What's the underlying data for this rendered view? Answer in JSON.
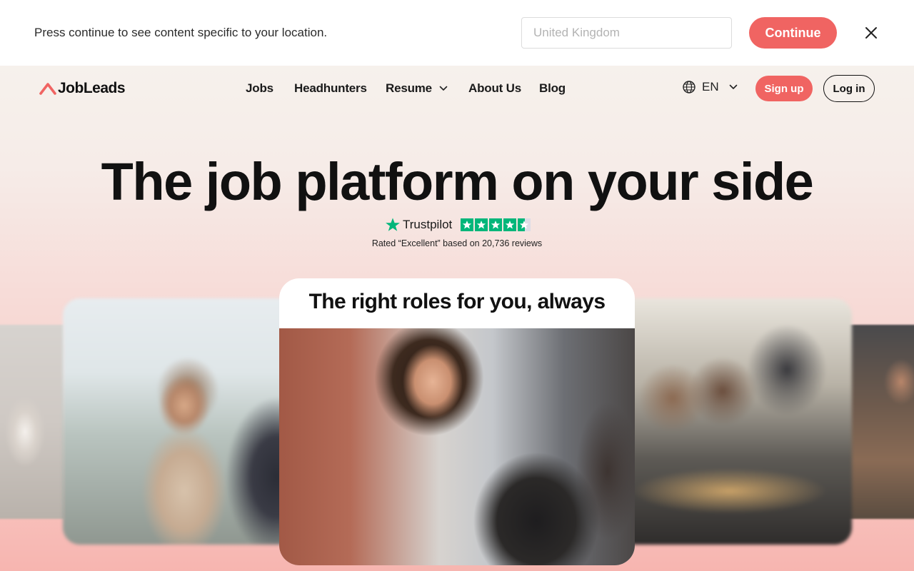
{
  "location_banner": {
    "message": "Press continue to see content specific to your location.",
    "country_placeholder": "United Kingdom",
    "continue_label": "Continue",
    "close_icon": "close-icon"
  },
  "header": {
    "logo_text": "JobLeads",
    "nav": [
      {
        "label": "Jobs"
      },
      {
        "label": "Headhunters"
      },
      {
        "label": "Resume",
        "has_dropdown": true
      },
      {
        "label": "About Us"
      },
      {
        "label": "Blog"
      }
    ],
    "language": "EN",
    "signup_label": "Sign up",
    "login_label": "Log in"
  },
  "hero": {
    "headline": "The job platform on your side",
    "trustpilot": {
      "brand": "Trustpilot",
      "rating_stars": 4.5,
      "caption": "Rated “Excellent” based on 20,736 reviews"
    },
    "card_title": "The right roles for you, always"
  },
  "colors": {
    "accent": "#f06462",
    "trustpilot_green": "#00b67a",
    "text": "#111111"
  }
}
